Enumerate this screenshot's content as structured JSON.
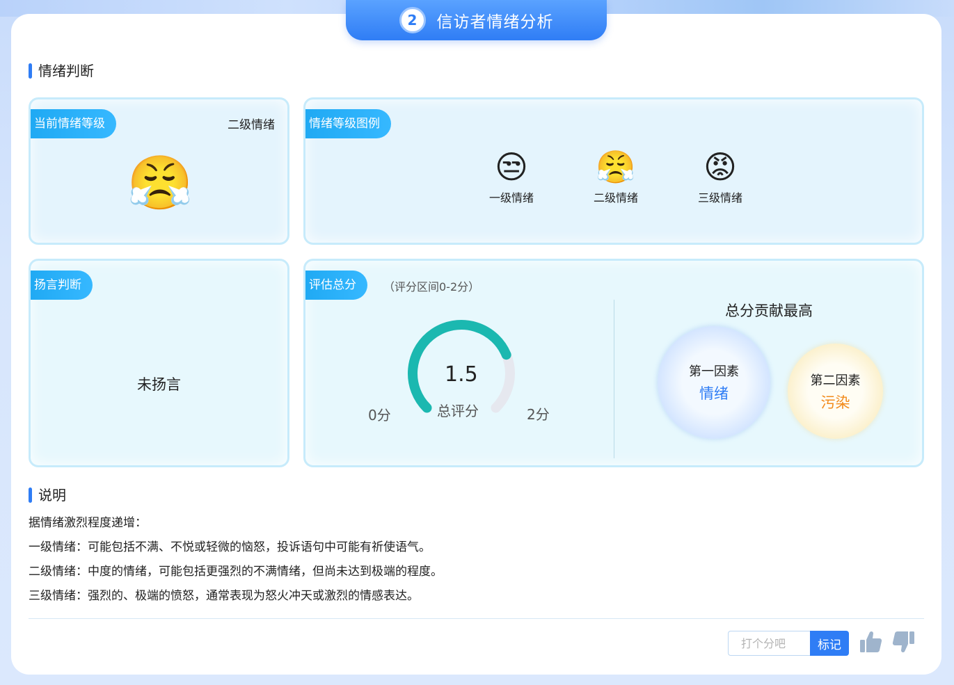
{
  "header": {
    "step_number": "2",
    "title": "信访者情绪分析"
  },
  "sections": {
    "emotion_judgement": "情绪判断",
    "explanation": "说明"
  },
  "current_level": {
    "tag": "当前情绪等级",
    "value": "二级情绪",
    "emoji": "😤"
  },
  "legend": {
    "tag": "情绪等级图例",
    "items": [
      {
        "emoji": "😒",
        "label": "一级情绪"
      },
      {
        "emoji": "😤",
        "label": "二级情绪"
      },
      {
        "emoji": "😡",
        "label": "三级情绪"
      }
    ]
  },
  "threat": {
    "tag": "扬言判断",
    "value": "未扬言"
  },
  "score": {
    "tag": "评估总分",
    "range_note": "（评分区间0-2分）",
    "value": "1.5",
    "value_numeric": 1.5,
    "min_numeric": 0,
    "max_numeric": 2,
    "label": "总评分",
    "min_label": "0分",
    "max_label": "2分",
    "arc_color": "#1bb8b0",
    "track_color": "#e6e8ef"
  },
  "top_factors": {
    "title": "总分贡献最高",
    "first": {
      "label": "第一因素",
      "value": "情绪",
      "color": "#2f7df5"
    },
    "second": {
      "label": "第二因素",
      "value": "污染",
      "color": "#f28b1c"
    }
  },
  "description": {
    "lines": [
      "据情绪激烈程度递增：",
      "一级情绪：可能包括不满、不悦或轻微的恼怒，投诉语句中可能有祈使语气。",
      "二级情绪：中度的情绪，可能包括更强烈的不满情绪，但尚未达到极端的程度。",
      "三级情绪：强烈的、极端的愤怒，通常表现为怒火冲天或激烈的情感表达。"
    ]
  },
  "footer": {
    "rate_placeholder": "打个分吧",
    "rate_value": "",
    "mark_label": "标记",
    "thumbs_up_icon": "thumbs-up-icon",
    "thumbs_down_icon": "thumbs-down-icon"
  }
}
